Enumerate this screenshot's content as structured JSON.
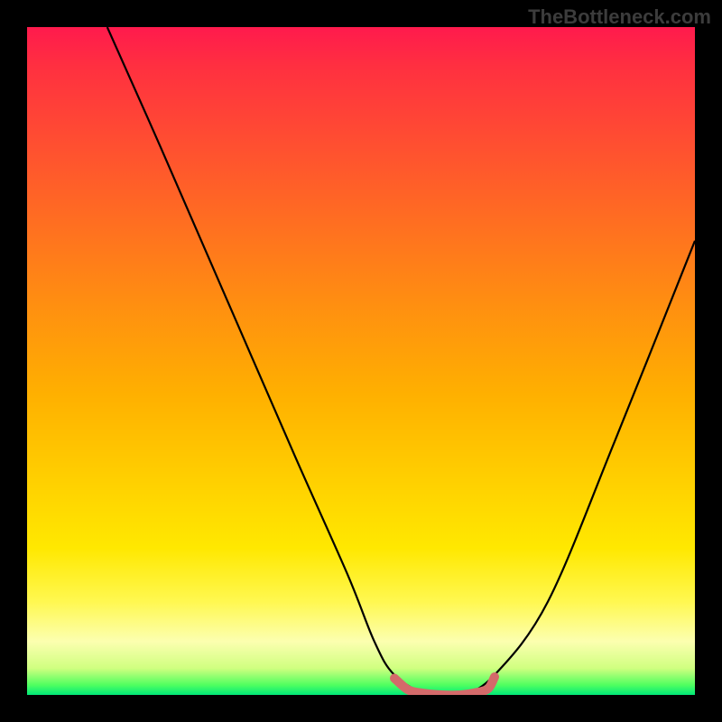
{
  "watermark": "TheBottleneck.com",
  "chart_data": {
    "type": "line",
    "title": "",
    "xlabel": "",
    "ylabel": "",
    "xlim": [
      0,
      100
    ],
    "ylim": [
      0,
      100
    ],
    "note": "V-shaped bottleneck curve over rainbow gradient; axes unlabeled; values estimated from pixel positions within 740x740 plot area mapped to 0-100",
    "series": [
      {
        "name": "main-curve",
        "x": [
          12,
          20,
          30,
          40,
          48,
          52,
          55,
          60,
          65,
          70,
          78,
          88,
          100
        ],
        "y": [
          100,
          82,
          59,
          36,
          18,
          8,
          3,
          0,
          0,
          3,
          14,
          38,
          68
        ]
      },
      {
        "name": "bottom-highlight",
        "x": [
          55,
          57,
          59,
          62,
          65,
          67,
          69,
          70
        ],
        "y": [
          2.5,
          0.8,
          0.3,
          0.0,
          0.0,
          0.3,
          0.9,
          2.7
        ]
      }
    ],
    "colors": {
      "curve": "#000000",
      "highlight": "#d46a6a",
      "background_top": "#ff1a4d",
      "background_bottom": "#00e878"
    }
  }
}
